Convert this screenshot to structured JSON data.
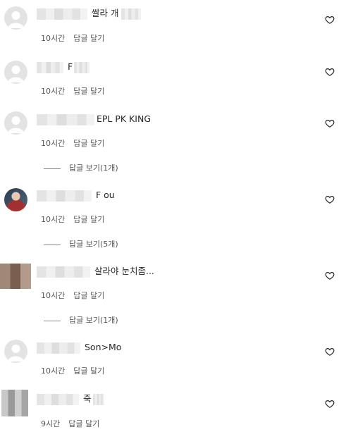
{
  "comments": [
    {
      "text": "쌀라 개",
      "time": "10시간",
      "reply": "답글 달기",
      "view_replies": null
    },
    {
      "text": "F",
      "time": "10시간",
      "reply": "답글 달기",
      "view_replies": null
    },
    {
      "text": "EPL PK KING",
      "time": "10시간",
      "reply": "답글 달기",
      "view_replies": "답글 보기(1개)"
    },
    {
      "text": "F        ou",
      "time": "10시간",
      "reply": "답글 달기",
      "view_replies": "답글 보기(5개)"
    },
    {
      "text": "살라야 눈치좀...",
      "time": "10시간",
      "reply": "답글 달기",
      "view_replies": "답글 보기(1개)"
    },
    {
      "text": "Son>Mo",
      "time": "10시간",
      "reply": "답글 달기",
      "view_replies": null
    },
    {
      "text": "죽",
      "time": "9시간",
      "reply": "답글 달기",
      "view_replies": null
    }
  ]
}
